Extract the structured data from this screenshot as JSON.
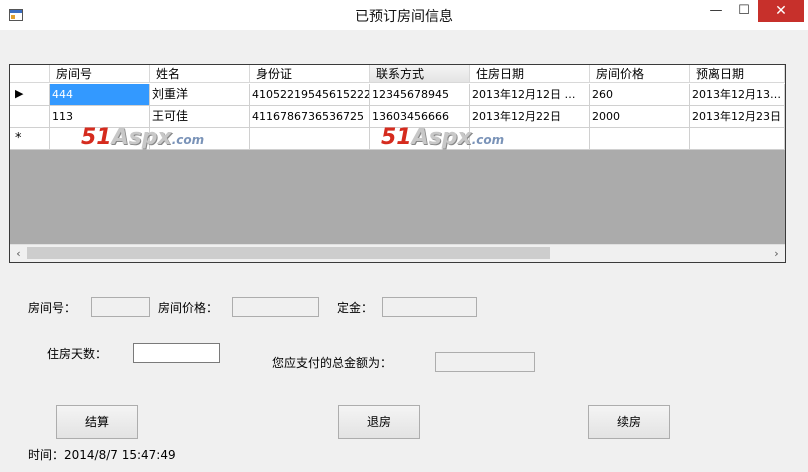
{
  "window": {
    "title": "已预订房间信息",
    "minimize": "—",
    "maximize": "☐",
    "close": "✕"
  },
  "grid": {
    "columns": [
      "房间号",
      "姓名",
      "身份证",
      "联系方式",
      "住房日期",
      "房间价格",
      "预离日期"
    ],
    "rows": [
      {
        "marker": "▶",
        "cells": [
          "444",
          "刘重洋",
          "410522195456152221",
          "12345678945",
          "2013年12月12日 …",
          "260",
          "2013年12月13…"
        ]
      },
      {
        "marker": "",
        "cells": [
          "113",
          "王可佳",
          "4116786736536725",
          "13603456666",
          "2013年12月22日",
          "2000",
          "2013年12月23日"
        ]
      }
    ],
    "new_row_marker": "*",
    "watermark": {
      "brand_num": "51",
      "brand_name": "Aspx",
      "brand_tld": ".com"
    },
    "scroll_left": "‹",
    "scroll_right": "›"
  },
  "form": {
    "room_number_label": "房间号：",
    "room_price_label": "房间价格：",
    "deposit_label": "定金：",
    "stay_days_label": "住房天数：",
    "total_label": "您应支付的总金额为："
  },
  "buttons": {
    "checkout": "结算",
    "leave": "退房",
    "renew": "续房"
  },
  "status": {
    "time": "时间：2014/8/7 15:47:49"
  }
}
